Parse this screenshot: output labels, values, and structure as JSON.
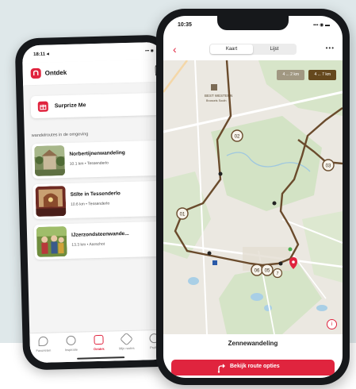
{
  "back_phone": {
    "status_time": "18:11 ◂",
    "status_icons": "▪▪▪ ◉",
    "app_title": "Ontdek",
    "surprise_label": "Surprize Me",
    "section_title": "wandelroutes in de omgeving",
    "routes": [
      {
        "title": "Norbertijnenwandeling",
        "meta": "10.1 km • Tessenderlo"
      },
      {
        "title": "Stilte in Tessenderlo",
        "meta": "10.6 km • Tessenderlo"
      },
      {
        "title": "IJzerzondsteenwande...",
        "meta": "13.3 km • Aarschot"
      }
    ],
    "tabs": [
      {
        "label": "Favorieten",
        "icon": "pin-icon"
      },
      {
        "label": "Inspiratie",
        "icon": "compass-icon"
      },
      {
        "label": "Ontdek",
        "icon": "discover-icon",
        "active": true
      },
      {
        "label": "Mijn routes",
        "icon": "star-icon"
      },
      {
        "label": "Profiel",
        "icon": "user-icon"
      }
    ]
  },
  "front_phone": {
    "status_time": "10:35",
    "status_icons": "▪▪▪ ◉ ▬",
    "segments": [
      "Kaart",
      "Lijst"
    ],
    "active_segment": "Kaart",
    "more_icon": "•••",
    "map": {
      "chip_left": "4 ... 2 km",
      "chip_right": "4 ... 7 km",
      "hotel_label": "BEST WESTERN",
      "hotel_sublabel": "Brussels South",
      "waypoints": [
        "02",
        "03",
        "01",
        "06",
        "05",
        "7"
      ],
      "colors": {
        "route": "#6a4b2c",
        "forest": "#cfe0c3",
        "road": "#ffffff",
        "water": "#a9cfe6"
      }
    },
    "route_name": "Zennewandeling",
    "cta_label": "Bekijk route opties",
    "accent": "#e0243e"
  }
}
